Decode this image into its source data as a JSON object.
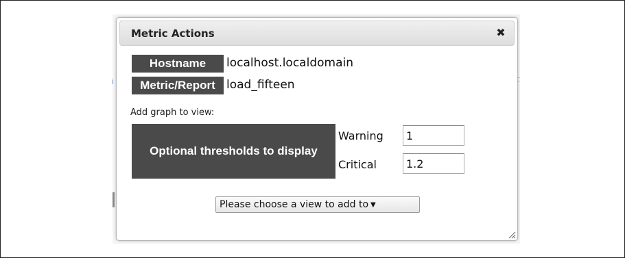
{
  "dialog": {
    "title": "Metric Actions",
    "close_icon": "close-icon",
    "close_glyph": "✖"
  },
  "info": {
    "hostname_label": "Hostname",
    "hostname_value": "localhost.localdomain",
    "metric_label": "Metric/Report",
    "metric_value": "load_fifteen"
  },
  "graph": {
    "add_label": "Add graph to view:",
    "thresholds_label": "Optional thresholds to display",
    "warning_label": "Warning",
    "warning_value": "1",
    "critical_label": "Critical",
    "critical_value": "1.2"
  },
  "view_select": {
    "selected": "Please choose a view to add to",
    "arrow_glyph": "▼"
  },
  "colors": {
    "label_bg": "#4a4a4a",
    "label_text": "#ffffff",
    "titlebar_bg": "#e6e6e6"
  }
}
